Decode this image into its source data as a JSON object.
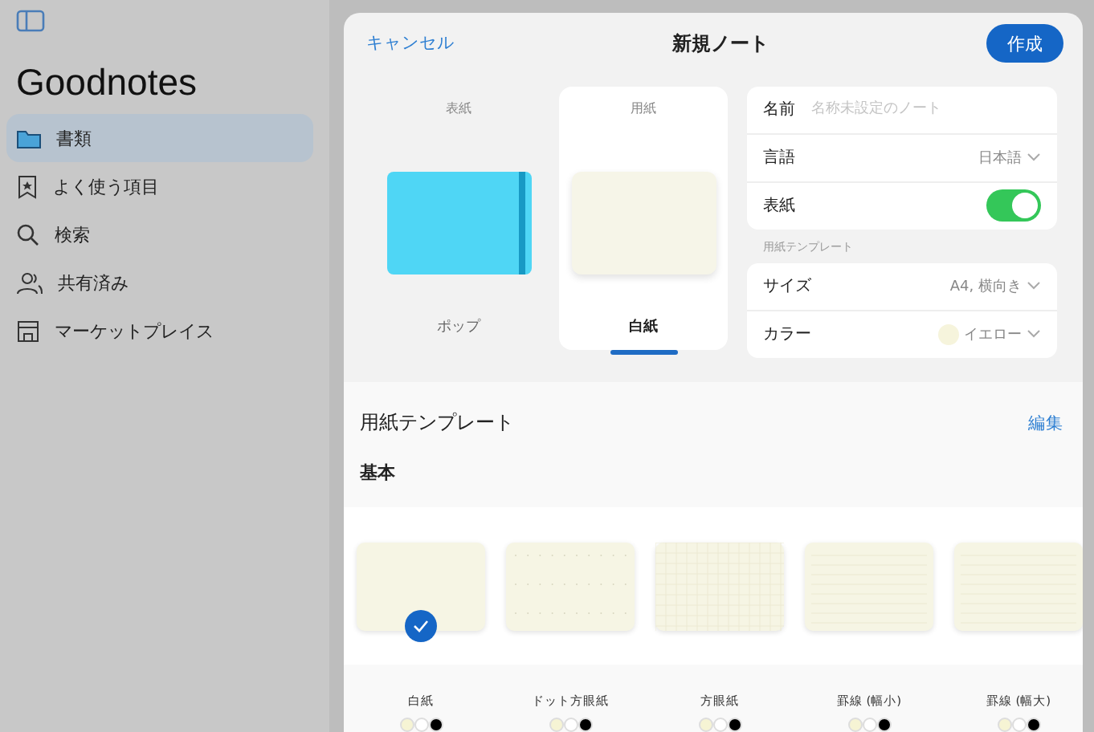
{
  "sidebar": {
    "title": "Goodnotes",
    "items": [
      {
        "label": "書類",
        "selected": true
      },
      {
        "label": "よく使う項目",
        "selected": false
      },
      {
        "label": "検索",
        "selected": false
      },
      {
        "label": "共有済み",
        "selected": false
      },
      {
        "label": "マーケットプレイス",
        "selected": false
      }
    ]
  },
  "dialog": {
    "cancel": "キャンセル",
    "title": "新規ノート",
    "create": "作成",
    "choices": [
      {
        "heading": "表紙",
        "name": "ポップ",
        "selected": false,
        "kind": "cover"
      },
      {
        "heading": "用紙",
        "name": "白紙",
        "selected": true,
        "kind": "paper"
      }
    ],
    "name_field": {
      "label": "名前",
      "placeholder": "名称未設定のノート"
    },
    "language": {
      "label": "言語",
      "value": "日本語"
    },
    "cover_toggle": {
      "label": "表紙",
      "on": true
    },
    "section_label": "用紙テンプレート",
    "size": {
      "label": "サイズ",
      "value": "A4, 横向き"
    },
    "paper_color": {
      "label": "カラー",
      "value": "イエロー",
      "color": "#f6f4dc"
    }
  },
  "templates": {
    "title": "用紙テンプレート",
    "edit": "編集",
    "group": "基本",
    "items": [
      {
        "name": "白紙",
        "selected": true,
        "kind": "plain",
        "swatches": [
          {
            "color": "#f6f4d4"
          },
          {
            "color": "#ffffff"
          },
          {
            "color": "#000000"
          }
        ]
      },
      {
        "name": "ドット方眼紙",
        "selected": false,
        "kind": "dots",
        "swatches": [
          {
            "color": "#f6f4d4"
          },
          {
            "color": "#ffffff"
          },
          {
            "color": "#000000"
          }
        ]
      },
      {
        "name": "方眼紙",
        "selected": false,
        "kind": "grid",
        "swatches": [
          {
            "color": "#f6f4d4"
          },
          {
            "color": "#ffffff"
          },
          {
            "color": "#000000"
          }
        ]
      },
      {
        "name": "罫線 (幅小)",
        "selected": false,
        "kind": "lines",
        "swatches": [
          {
            "color": "#f6f4d4"
          },
          {
            "color": "#ffffff"
          },
          {
            "color": "#000000"
          }
        ]
      },
      {
        "name": "罫線 (幅大)",
        "selected": false,
        "kind": "lines",
        "swatches": [
          {
            "color": "#f6f4d4"
          },
          {
            "color": "#ffffff"
          },
          {
            "color": "#000000"
          }
        ]
      }
    ]
  }
}
